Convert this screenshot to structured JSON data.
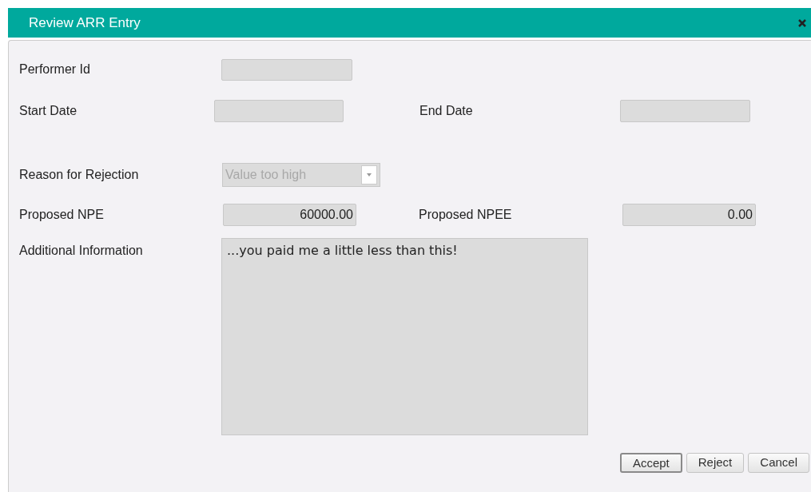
{
  "window": {
    "title": "Review ARR Entry"
  },
  "fields": {
    "performer_id": {
      "label": "Performer Id"
    },
    "start_date": {
      "label": "Start Date"
    },
    "end_date": {
      "label": "End Date"
    },
    "reason": {
      "label": "Reason for Rejection",
      "value": "Value too high",
      "disabled": true
    },
    "proposed_npe": {
      "label": "Proposed NPE",
      "value": "60000.00"
    },
    "proposed_npee": {
      "label": "Proposed NPEE",
      "value": "0.00"
    },
    "additional_info": {
      "label": "Additional Information",
      "value": "...you paid me a little less than this!"
    }
  },
  "buttons": [
    {
      "label": "Accept",
      "default": true
    },
    {
      "label": "Reject",
      "default": false
    },
    {
      "label": "Cancel",
      "default": false
    }
  ]
}
